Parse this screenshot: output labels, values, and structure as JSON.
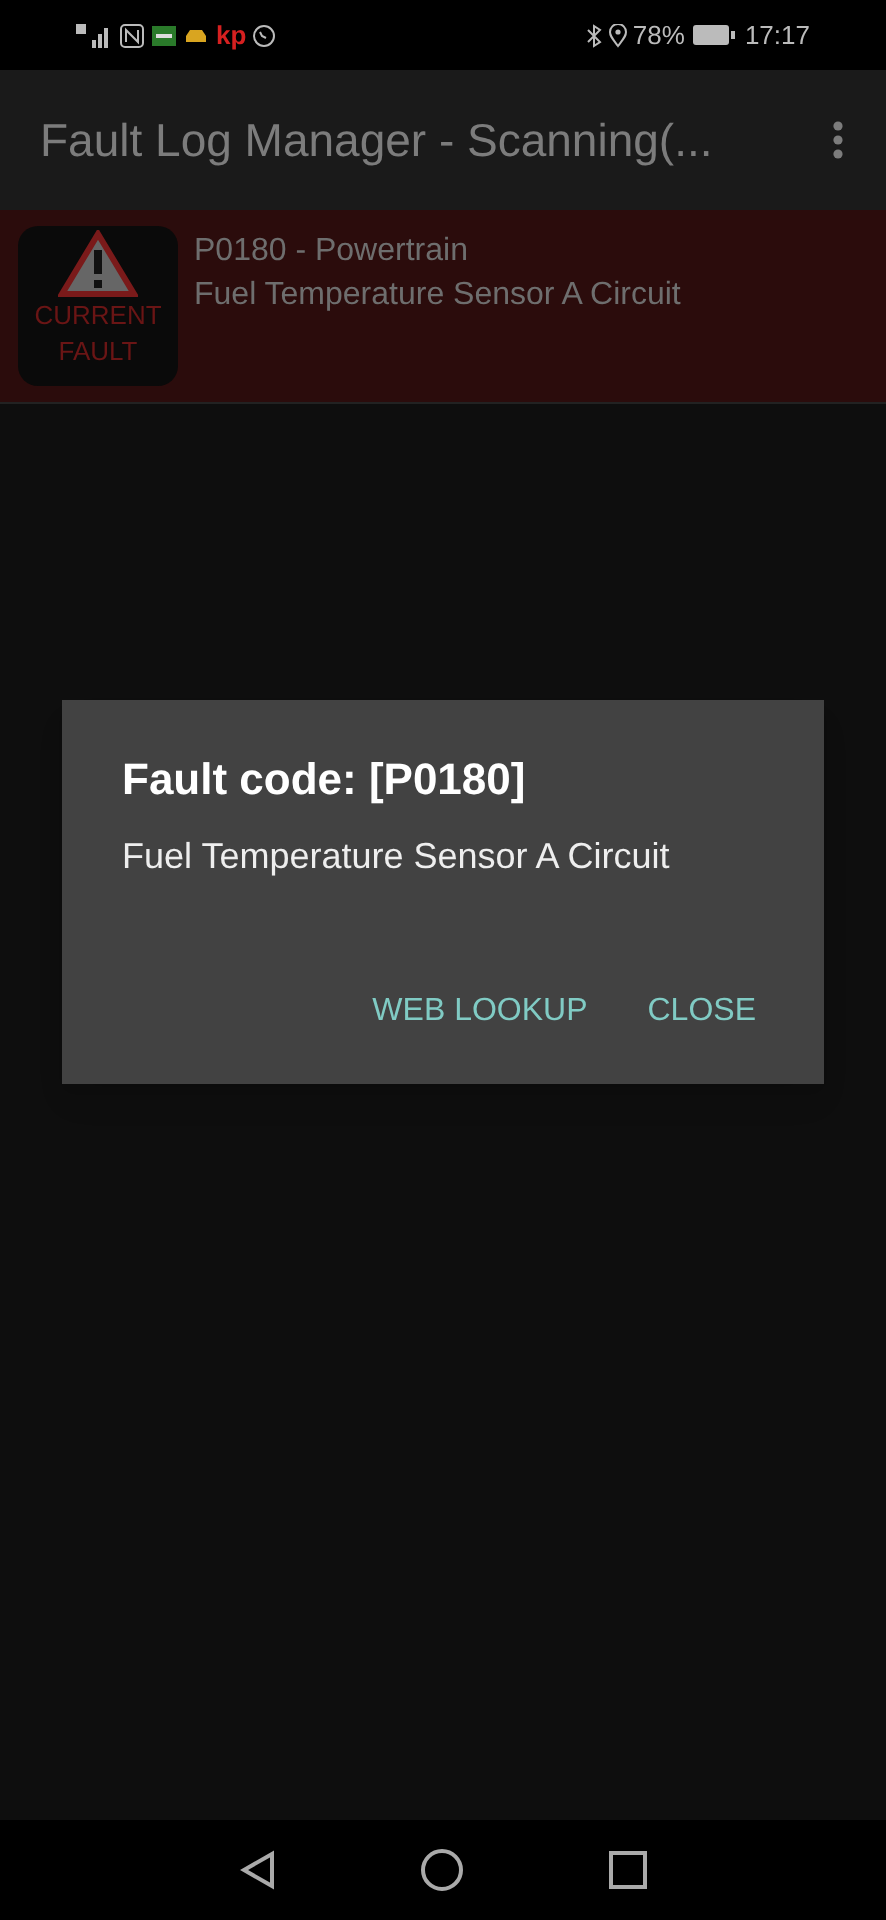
{
  "status_bar": {
    "logo_text": "kp",
    "battery": "78%",
    "time": "17:17"
  },
  "app_bar": {
    "title": "Fault Log Manager - Scanning(..."
  },
  "faults": [
    {
      "badge": [
        "CURRENT",
        "FAULT"
      ],
      "code_line": "P0180 - Powertrain",
      "description": "Fuel Temperature Sensor A Circuit"
    }
  ],
  "dialog": {
    "title": "Fault code: [P0180]",
    "message": "Fuel Temperature Sensor A Circuit",
    "buttons": [
      "WEB LOOKUP",
      "CLOSE"
    ]
  }
}
